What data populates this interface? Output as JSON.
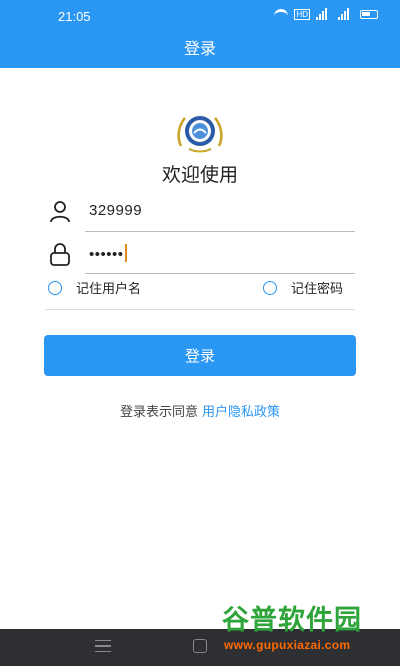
{
  "status_bar": {
    "time": "21:05",
    "hd_label": "HD"
  },
  "app_bar": {
    "title": "登录"
  },
  "welcome_text": "欢迎使用",
  "username": {
    "value": "329999",
    "icon": "user-icon"
  },
  "password": {
    "value": "••••••",
    "icon": "lock-icon"
  },
  "remember_username": {
    "label": "记住用户名",
    "checked": false
  },
  "remember_password": {
    "label": "记住密码",
    "checked": false
  },
  "login_button": {
    "label": "登录"
  },
  "agreement": {
    "text": "登录表示同意",
    "link": "用户隐私政策"
  },
  "watermark": {
    "title": "谷普软件园",
    "url": "www.gupuxiazai.com"
  },
  "colors": {
    "primary": "#2b97f4",
    "nav_bar": "#2e2f33",
    "watermark_green": "#2fa43a",
    "watermark_orange": "#ff6a00"
  }
}
